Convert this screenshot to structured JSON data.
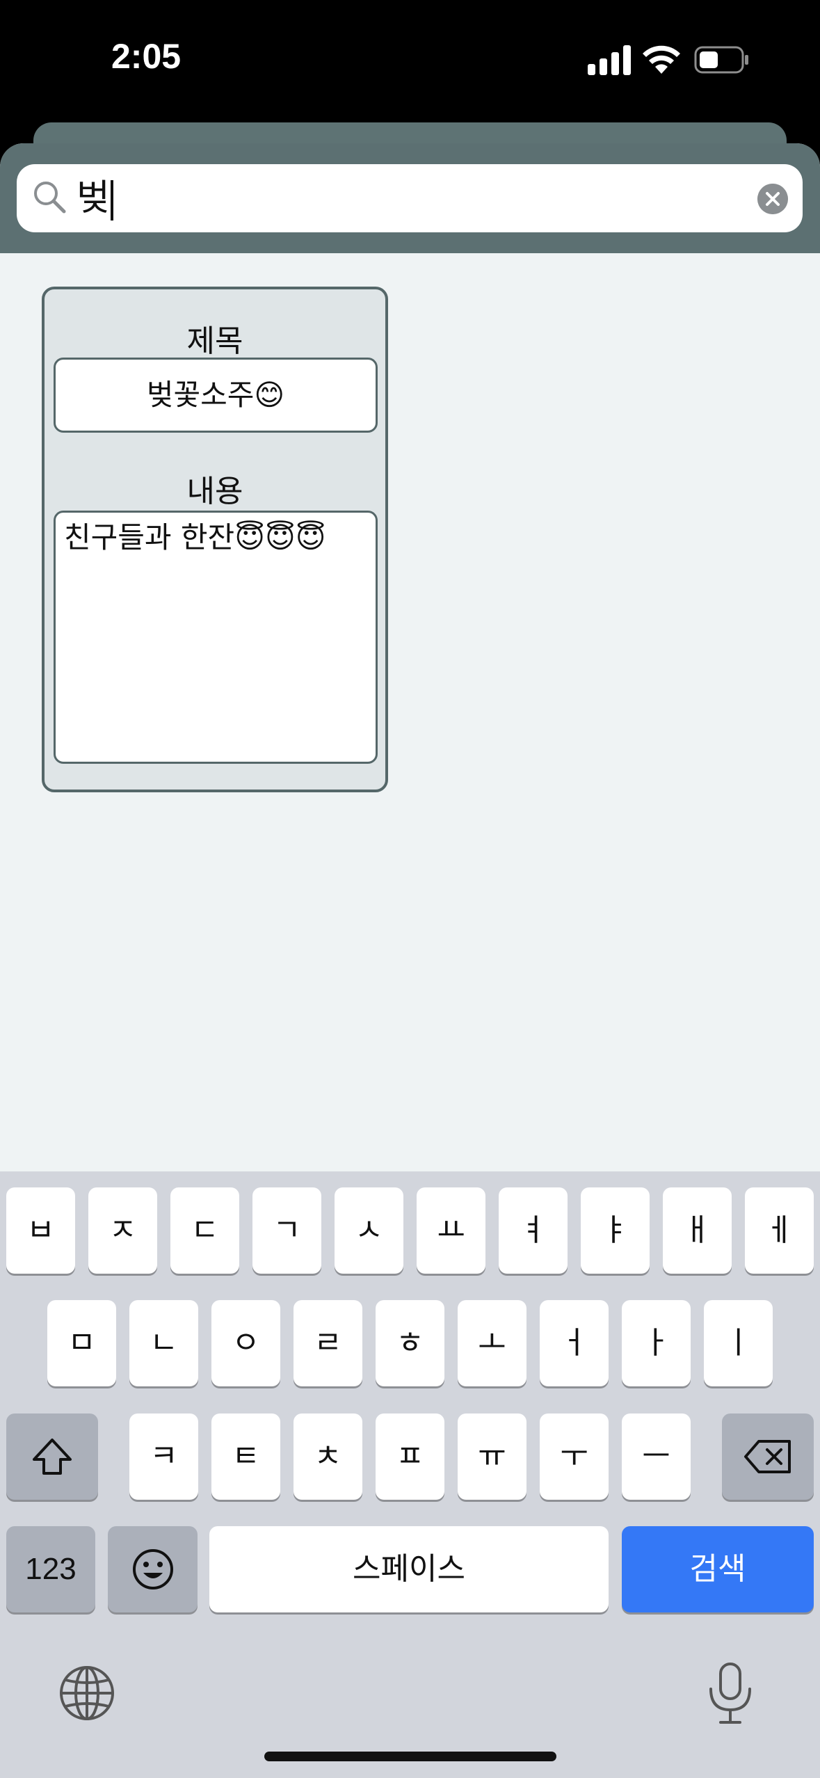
{
  "status_bar": {
    "time": "2:05"
  },
  "search": {
    "query": "벚",
    "clear_icon": "clear-icon",
    "search_icon": "magnifier-icon"
  },
  "memo": {
    "title_label": "제목",
    "title_value": "벚꽃소주😊",
    "content_label": "내용",
    "content_value": "친구들과 한잔😇😇😇"
  },
  "keyboard": {
    "row1": [
      "ㅂ",
      "ㅈ",
      "ㄷ",
      "ㄱ",
      "ㅅ",
      "ㅛ",
      "ㅕ",
      "ㅑ",
      "ㅐ",
      "ㅔ"
    ],
    "row2": [
      "ㅁ",
      "ㄴ",
      "ㅇ",
      "ㄹ",
      "ㅎ",
      "ㅗ",
      "ㅓ",
      "ㅏ",
      "ㅣ"
    ],
    "row3": [
      "ㅋ",
      "ㅌ",
      "ㅊ",
      "ㅍ",
      "ㅠ",
      "ㅜ",
      "ㅡ"
    ],
    "numbers_label": "123",
    "space_label": "스페이스",
    "search_label": "검색"
  },
  "colors": {
    "accent_blue": "#3478f6",
    "header_teal": "#5c7072",
    "card_border": "#556769"
  }
}
